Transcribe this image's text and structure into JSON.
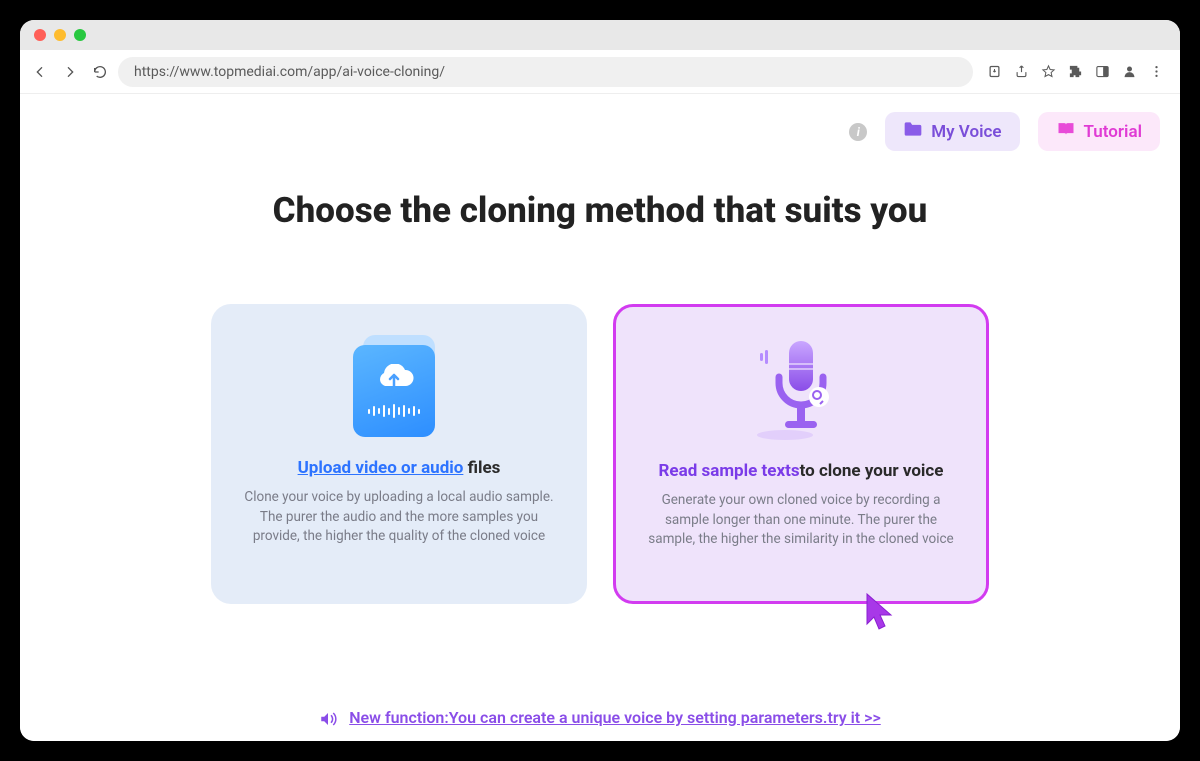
{
  "browser": {
    "url": "https://www.topmediai.com/app/ai-voice-cloning/"
  },
  "header": {
    "my_voice": "My Voice",
    "tutorial": "Tutorial"
  },
  "title": "Choose the cloning method that suits you",
  "cards": {
    "upload": {
      "title_accent": "Upload video or audio",
      "title_rest": " files",
      "desc": "Clone your voice by uploading a local audio sample. The purer the audio and the more samples you provide, the higher the quality of the cloned voice"
    },
    "read": {
      "title_accent": "Read sample texts",
      "title_rest": "to clone your voice",
      "desc": "Generate your own cloned voice by recording a sample longer than one minute. The purer the sample, the higher the similarity in the cloned voice"
    }
  },
  "bottom_link": "New function:You can create a unique voice by setting parameters.try it >>"
}
